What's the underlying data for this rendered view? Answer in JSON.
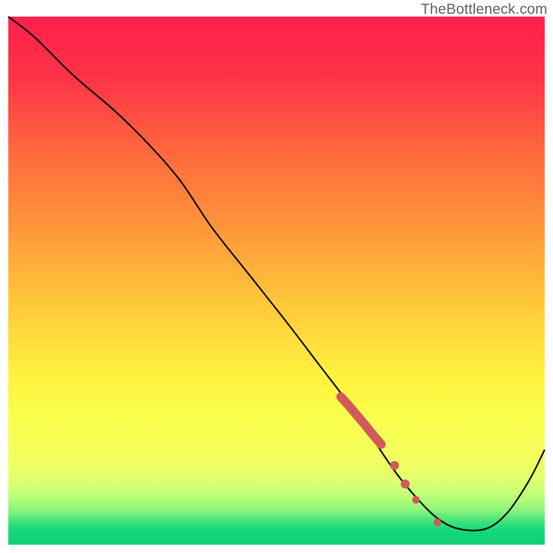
{
  "watermark": "TheBottleneck.com",
  "colors": {
    "gradient_top": "#ff1f4b",
    "gradient_mid_upper": "#ff7a37",
    "gradient_mid": "#ffd23a",
    "gradient_mid_lower": "#fff94a",
    "gradient_low_yellowgreen": "#e9ff65",
    "gradient_bottom_green": "#14e07a",
    "curve": "#000000",
    "marker": "#d05a5a",
    "border": "#ffffff"
  },
  "chart_data": {
    "type": "line",
    "title": "",
    "xlabel": "",
    "ylabel": "",
    "xlim": [
      0,
      100
    ],
    "ylim": [
      0,
      100
    ],
    "series": [
      {
        "name": "bottleneck-curve",
        "x": [
          0,
          5,
          12,
          20,
          26,
          32,
          38,
          45,
          52,
          58,
          64,
          68,
          72,
          76,
          80,
          84,
          89,
          93,
          97,
          100
        ],
        "y": [
          100,
          96,
          89,
          82,
          76,
          69,
          60,
          51,
          42,
          34,
          26,
          20,
          14,
          9,
          5,
          3,
          3,
          6,
          12,
          18
        ]
      }
    ],
    "highlight_band": {
      "name": "marker-cluster",
      "x": [
        62,
        63.5,
        65,
        66.5,
        68,
        69.5,
        72,
        74,
        76,
        80
      ],
      "y": [
        28,
        26.3,
        24.5,
        22.7,
        20.8,
        19,
        15,
        11.5,
        8.5,
        4.2
      ]
    }
  }
}
